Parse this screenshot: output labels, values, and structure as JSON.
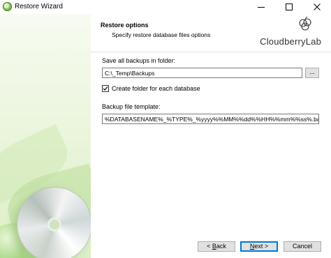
{
  "window": {
    "title": "Restore Wizard"
  },
  "header": {
    "title": "Restore options",
    "subtitle": "Specify restore database files options",
    "logo_text": "CloudberryLab"
  },
  "form": {
    "save_label": "Save all backups in folder:",
    "folder_path": "C:\\_Temp\\Backups",
    "browse_label": "...",
    "create_folder_label": "Create folder for each database",
    "create_folder_checked": true,
    "template_label": "Backup file template:",
    "template_value": "%DATABASENAME%_%TYPE%_%yyyy%%MM%%dd%%HH%%mm%%ss%.bak"
  },
  "buttons": {
    "back_prefix": "< ",
    "back_mnemonic": "B",
    "back_rest": "ack",
    "next_mnemonic": "N",
    "next_rest": "ext >",
    "cancel": "Cancel"
  },
  "colors": {
    "accent": "#0078d7",
    "brand_green": "#5ea83a"
  }
}
